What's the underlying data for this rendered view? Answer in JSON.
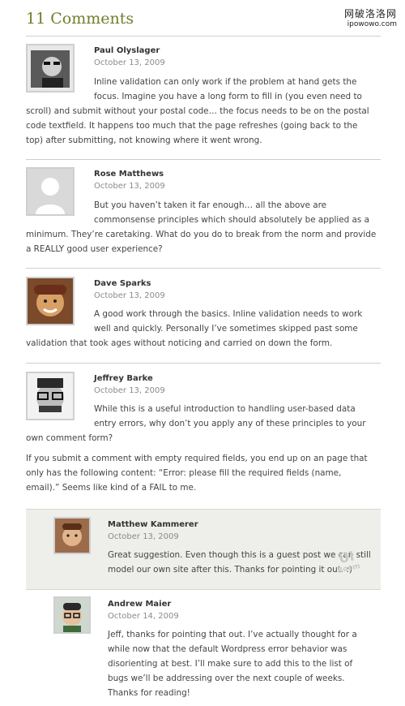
{
  "header": {
    "title": "11 Comments"
  },
  "site_mark": {
    "name": "网破洛洛网",
    "url": "ipowowo.com"
  },
  "comments": [
    {
      "author": "Paul Olyslager",
      "date": "October 13, 2009",
      "avatar_icon": "user-photo-icon",
      "text_lines": [
        "Inline validation can only work if the problem at hand gets the",
        "focus. Imagine you have a long form to fill in (you even need to",
        "scroll) and submit without your postal code… the focus needs to be on the postal",
        "code textfield. It happens too much that the page refreshes (going back to the",
        "top) after submitting, not knowing where it went wrong."
      ]
    },
    {
      "author": "Rose Matthews",
      "date": "October 13, 2009",
      "avatar_icon": "default-avatar-icon",
      "text_lines": [
        "But you haven’t taken it far enough… all the above are",
        "commonsense principles which should absolutely be applied as a",
        "minimum. They’re caretaking. What do you do to break from the norm and provide",
        "a REALLY good user experience?"
      ]
    },
    {
      "author": "Dave Sparks",
      "date": "October 13, 2009",
      "avatar_icon": "user-photo-icon",
      "text_lines": [
        "A good work through the basics. Inline validation needs to work",
        "well and quickly. Personally I’ve sometimes skipped past some",
        "validation that took ages without noticing and carried on down the form."
      ]
    },
    {
      "author": "Jeffrey Barke",
      "date": "October 13, 2009",
      "avatar_icon": "user-photo-icon",
      "text_lines": [
        "While this is a useful introduction to handling user-based data",
        "entry errors, why don’t you apply any of these principles to your",
        "own comment form?"
      ],
      "text_lines_2": [
        "If you submit a comment with empty required fields, you end up on an page that",
        "only has the following content: “Error: please fill the required fields (name,",
        "email).” Seems like kind of a FAIL to me."
      ]
    },
    {
      "author": "Matthew Kammerer",
      "date": "October 13, 2009",
      "avatar_icon": "user-photo-icon",
      "text_lines": [
        "Great suggestion. Even though this is a guest post we can still",
        "model our own site after this. Thanks for pointing it out. :)"
      ]
    },
    {
      "author": "Andrew Maier",
      "date": "October 14, 2009",
      "avatar_icon": "user-photo-icon",
      "text_lines": [
        "Jeff, thanks for pointing that out. I’ve actually thought for a",
        "while now that the default Wordpress error behavior was",
        "disorienting at best. I’ll make sure to add this to the list of",
        "bugs we’ll be addressing over the next couple of weeks.",
        "Thanks for reading!"
      ]
    }
  ],
  "watermark": {
    "line1": "UI",
    "line2": "Room"
  }
}
